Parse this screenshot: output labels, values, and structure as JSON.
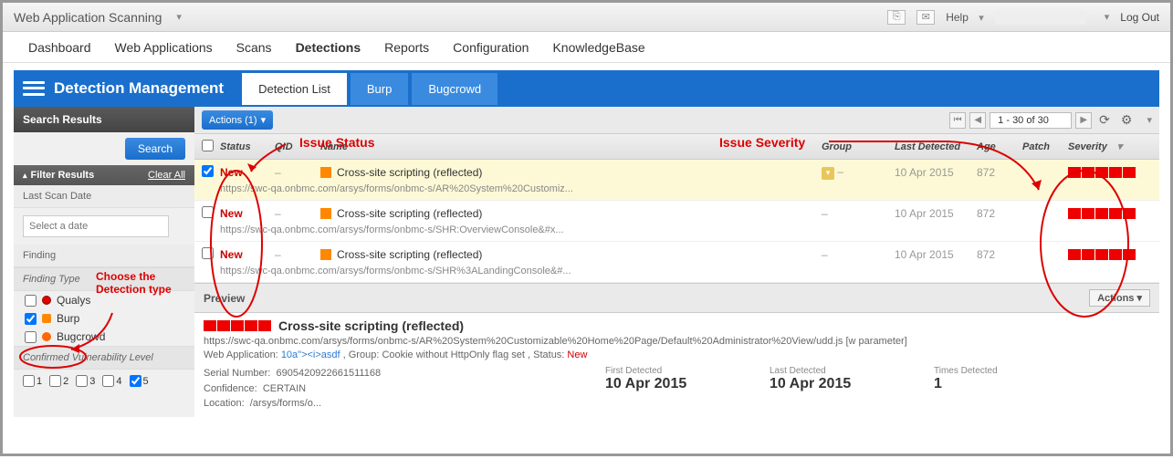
{
  "topbar": {
    "app_title": "Web Application Scanning",
    "help": "Help",
    "logout": "Log Out"
  },
  "nav": {
    "items": [
      "Dashboard",
      "Web Applications",
      "Scans",
      "Detections",
      "Reports",
      "Configuration",
      "KnowledgeBase"
    ],
    "active": 3
  },
  "bluebar": {
    "title": "Detection Management",
    "tabs": [
      "Detection List",
      "Burp",
      "Bugcrowd"
    ],
    "active": 0
  },
  "sidebar": {
    "search_header": "Search Results",
    "search_btn": "Search",
    "filter_header": "Filter Results",
    "clear_all": "Clear All",
    "last_scan": "Last Scan Date",
    "date_placeholder": "Select a date",
    "finding": "Finding",
    "finding_type": "Finding Type",
    "types": [
      {
        "label": "Qualys",
        "checked": false
      },
      {
        "label": "Burp",
        "checked": true
      },
      {
        "label": "Bugcrowd",
        "checked": false
      }
    ],
    "cvl": "Confirmed Vulnerability Level",
    "levels": [
      "1",
      "2",
      "3",
      "4",
      "5"
    ]
  },
  "toolbar": {
    "actions": "Actions (1)",
    "pager": "1 - 30 of 30"
  },
  "columns": {
    "status": "Status",
    "qid": "QID",
    "name": "Name",
    "group": "Group",
    "ld": "Last Detected",
    "age": "Age",
    "patch": "Patch",
    "sev": "Severity"
  },
  "rows": [
    {
      "selected": true,
      "status": "New",
      "qid": "–",
      "name": "Cross-site scripting (reflected)",
      "url": "https://swc-qa.onbmc.com/arsys/forms/onbmc-s/AR%20System%20Customiz...",
      "group_badge": true,
      "group": "–",
      "ld": "10 Apr 2015",
      "age": "872"
    },
    {
      "selected": false,
      "status": "New",
      "qid": "–",
      "name": "Cross-site scripting (reflected)",
      "url": "https://swc-qa.onbmc.com/arsys/forms/onbmc-s/SHR:OverviewConsole&#x...",
      "group_badge": false,
      "group": "–",
      "ld": "10 Apr 2015",
      "age": "872"
    },
    {
      "selected": false,
      "status": "New",
      "qid": "–",
      "name": "Cross-site scripting (reflected)",
      "url": "https://swc-qa.onbmc.com/arsys/forms/onbmc-s/SHR%3ALandingConsole&#...",
      "group_badge": false,
      "group": "–",
      "ld": "10 Apr 2015",
      "age": "872"
    }
  ],
  "preview": {
    "header": "Preview",
    "actions": "Actions",
    "title": "Cross-site scripting (reflected)",
    "url": "https://swc-qa.onbmc.com/arsys/forms/onbmc-s/AR%20System%20Customizable%20Home%20Page/Default%20Administrator%20View/udd.js [w parameter]",
    "webapp_label": "Web Application:",
    "webapp_link": "10a\"><i>asdf",
    "group_text": ", Group: Cookie without HttpOnly flag set , Status: ",
    "status": "New",
    "serial_label": "Serial Number:",
    "serial": "6905420922661511168",
    "conf_label": "Confidence:",
    "conf": "CERTAIN",
    "loc_label": "Location:",
    "loc": "/arsys/forms/o...",
    "fd_label": "First Detected",
    "fd": "10 Apr 2015",
    "ld_label": "Last Detected",
    "ld": "10 Apr 2015",
    "td_label": "Times Detected",
    "td": "1"
  },
  "annotations": {
    "issue_status": "Issue Status",
    "issue_severity": "Issue Severity",
    "choose": "Choose the Detection type"
  }
}
